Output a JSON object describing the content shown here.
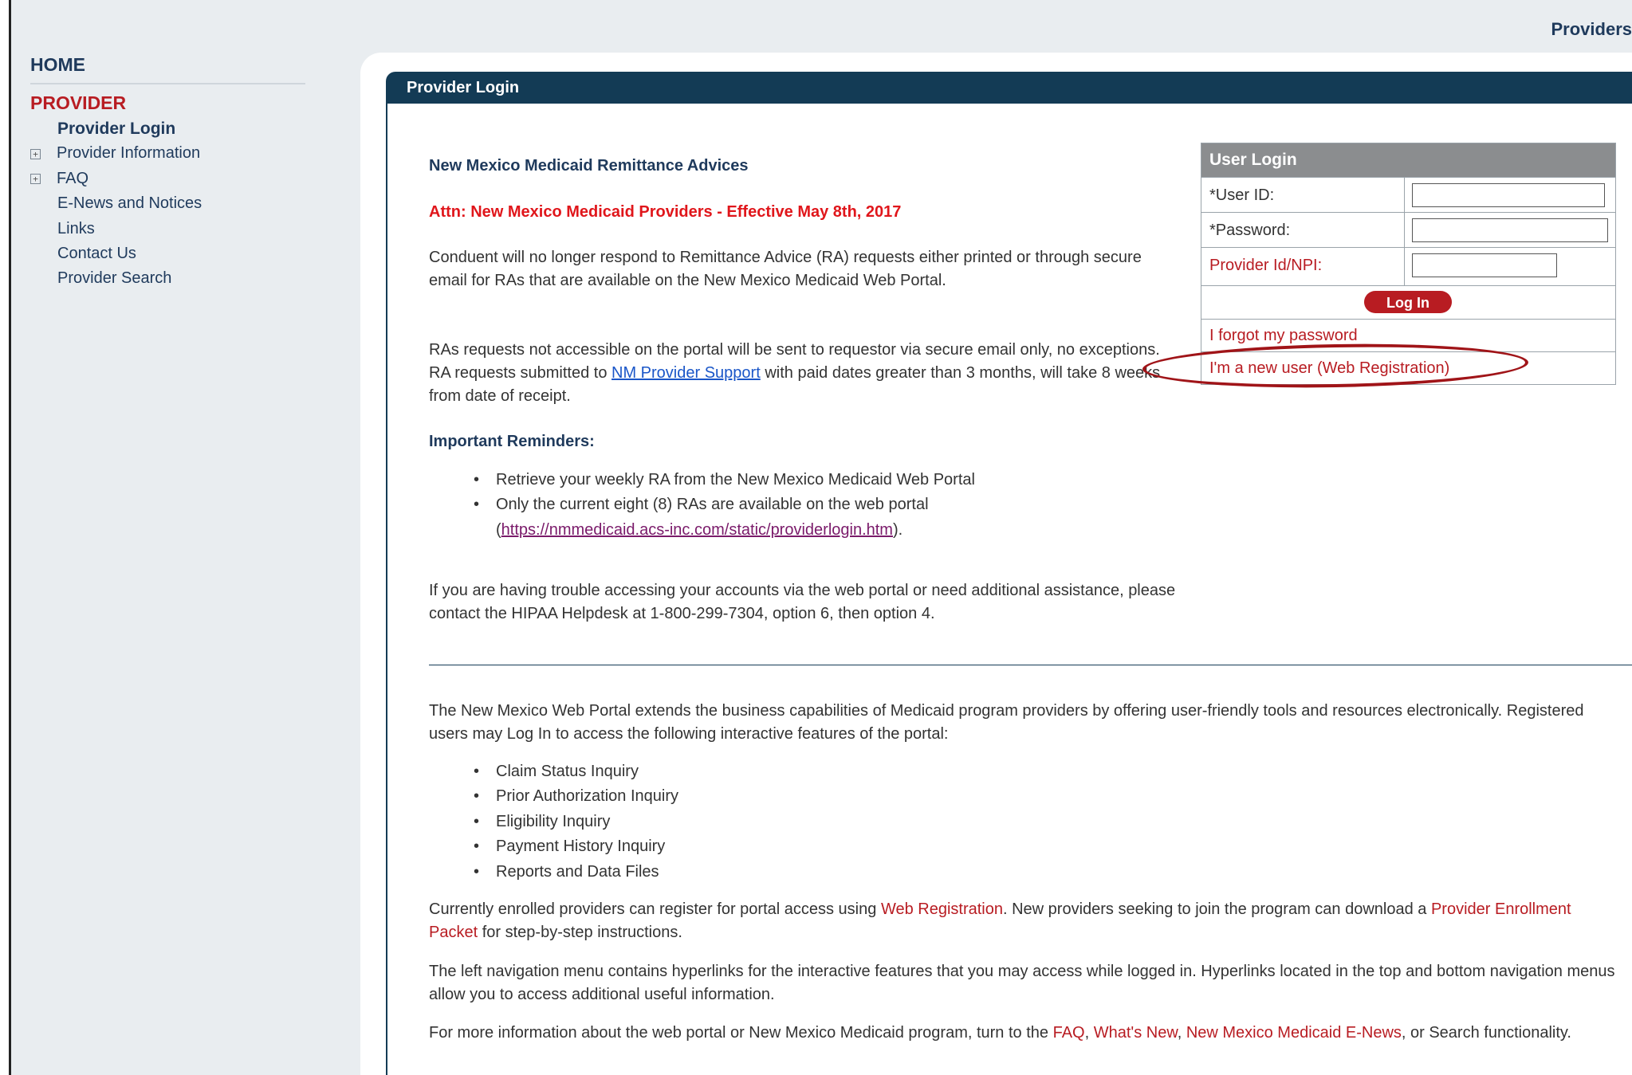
{
  "header": {
    "section_title": "Providers"
  },
  "sidebar": {
    "home": "HOME",
    "section": "PROVIDER",
    "items": [
      {
        "label": "Provider Login",
        "active": true,
        "expandable": false
      },
      {
        "label": "Provider Information",
        "active": false,
        "expandable": true
      },
      {
        "label": "FAQ",
        "active": false,
        "expandable": true
      },
      {
        "label": "E-News and Notices",
        "active": false,
        "expandable": false
      },
      {
        "label": "Links",
        "active": false,
        "expandable": false
      },
      {
        "label": "Contact Us",
        "active": false,
        "expandable": false
      },
      {
        "label": "Provider Search",
        "active": false,
        "expandable": false
      }
    ],
    "expand_glyph": "+"
  },
  "panel": {
    "title": "Provider Login"
  },
  "notice": {
    "title": "New Mexico Medicaid Remittance Advices",
    "attn": "Attn: New Mexico Medicaid Providers - Effective May 8th, 2017",
    "p1": "Conduent will no longer respond to Remittance Advice (RA) requests either printed or through secure email for RAs that are available on the New Mexico Medicaid Web Portal.",
    "p2_a": "RAs requests not accessible on the portal will be sent to requestor via secure email only, no exceptions. RA requests submitted to ",
    "p2_link": "NM Provider Support",
    "p2_b": " with paid dates greater than 3 months, will take 8 weeks from date of receipt.",
    "reminders_title": "Important Reminders:",
    "reminder_1": "Retrieve your weekly RA from the New Mexico Medicaid Web Portal",
    "reminder_2": "Only the current eight (8) RAs are available on the web portal",
    "reminder_2_link": "https://nmmedicaid.acs-inc.com/static/providerlogin.htm",
    "p3": "If you are having trouble accessing your accounts via the web portal or need additional assistance, please contact the HIPAA Helpdesk at 1-800-299-7304, option 6, then option 4."
  },
  "portal": {
    "intro": "The New Mexico Web Portal extends the business capabilities of Medicaid program providers by offering user-friendly tools and resources electronically. Registered users may Log In to access the following interactive features of the portal:",
    "features": [
      "Claim Status Inquiry",
      "Prior Authorization Inquiry",
      "Eligibility Inquiry",
      "Payment History Inquiry",
      "Reports and Data Files"
    ],
    "enroll_a": "Currently enrolled providers can register for portal access using ",
    "enroll_link1": "Web Registration",
    "enroll_b": ". New providers seeking to join the program can download a ",
    "enroll_link2": "Provider Enrollment Packet",
    "enroll_c": " for step-by-step instructions.",
    "nav_info": "The left navigation menu contains hyperlinks for the interactive features that you may access while logged in. Hyperlinks located in the top and bottom navigation menus allow you to access additional useful information.",
    "more_a": "For more information about the web portal or New Mexico Medicaid program, turn to the ",
    "more_faq": "FAQ",
    "more_sep1": ", ",
    "more_whatsnew": "What's New",
    "more_sep2": ", ",
    "more_enews": "New Mexico Medicaid E-News",
    "more_b": ", or Search functionality."
  },
  "login": {
    "title": "User Login",
    "user_id_label": "*User ID:",
    "user_id_value": "",
    "password_label": "*Password:",
    "password_value": "",
    "npi_label": "Provider Id/NPI:",
    "npi_value": "",
    "button": "Log In",
    "forgot": "I forgot my password",
    "new_user": "I'm a new user (Web Registration)"
  },
  "colors": {
    "accent_red": "#b81c22",
    "header_navy": "#133b55",
    "annotation_red": "#a01418"
  }
}
